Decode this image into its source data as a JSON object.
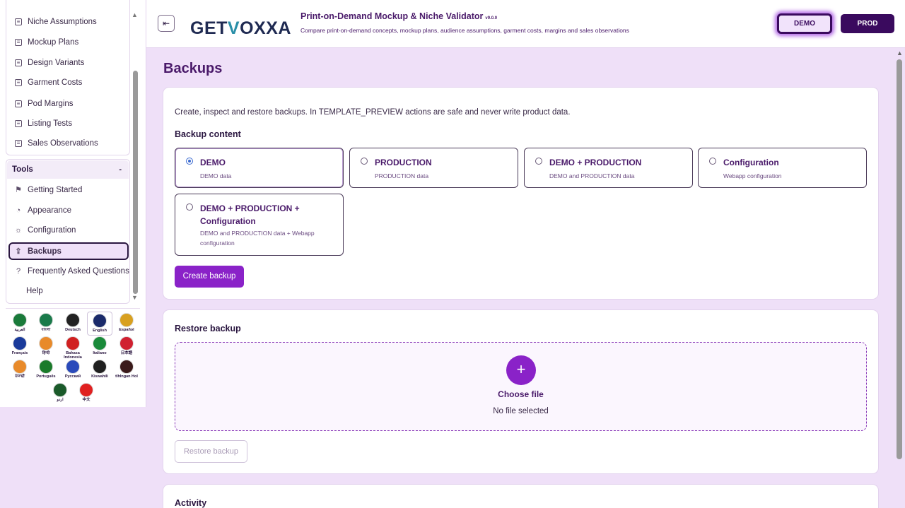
{
  "sidebar": {
    "nav_items": [
      {
        "label": "Niche Assumptions",
        "icon": "list-icon"
      },
      {
        "label": "Mockup Plans",
        "icon": "list-icon"
      },
      {
        "label": "Design Variants",
        "icon": "list-icon"
      },
      {
        "label": "Garment Costs",
        "icon": "list-icon"
      },
      {
        "label": "Pod Margins",
        "icon": "list-icon"
      },
      {
        "label": "Listing Tests",
        "icon": "list-icon"
      },
      {
        "label": "Sales Observations",
        "icon": "list-icon"
      }
    ],
    "tools_title": "Tools",
    "tools_caret": "-",
    "tools_items": [
      {
        "label": "Getting Started",
        "icon": "flag-icon"
      },
      {
        "label": "Appearance",
        "icon": "palette-icon"
      },
      {
        "label": "Configuration",
        "icon": "gear-icon"
      },
      {
        "label": "Backups",
        "icon": "upload-icon"
      },
      {
        "label": "Frequently Asked Questions",
        "icon": "help-icon"
      },
      {
        "label": "Help",
        "icon": ""
      }
    ],
    "languages": [
      {
        "label": "العربية",
        "color": "#1a7a3a"
      },
      {
        "label": "বাংলা",
        "color": "#1a7a4a"
      },
      {
        "label": "Deutsch",
        "color": "#222222"
      },
      {
        "label": "English",
        "color": "#1a2a6a"
      },
      {
        "label": "Español",
        "color": "#d8a020"
      },
      {
        "label": "Français",
        "color": "#1a3a9a"
      },
      {
        "label": "हिन्दी",
        "color": "#e88a2a"
      },
      {
        "label": "Bahasa Indonesia",
        "color": "#d02020"
      },
      {
        "label": "Italiano",
        "color": "#1a8a3a"
      },
      {
        "label": "日本語",
        "color": "#d02030"
      },
      {
        "label": "ਪੰਜਾਬੀ",
        "color": "#e88a2a"
      },
      {
        "label": "Português",
        "color": "#1a7a2a"
      },
      {
        "label": "Русский",
        "color": "#2a4aba"
      },
      {
        "label": "Kiswahili",
        "color": "#202020"
      },
      {
        "label": "tlhIngan Hol",
        "color": "#3a1a1a"
      },
      {
        "label": "اردو",
        "color": "#1a5a2a"
      },
      {
        "label": "中文",
        "color": "#e02020"
      }
    ]
  },
  "header": {
    "logo_pre": "GET",
    "logo_v": "V",
    "logo_post": "OXXA",
    "title": "Print-on-Demand Mockup & Niche Validator",
    "version": "v9.0.0",
    "subtitle": "Compare print-on-demand concepts, mockup plans, audience assumptions, garment costs, margins and sales observations",
    "demo_label": "DEMO",
    "prod_label": "PROD"
  },
  "main": {
    "page_title": "Backups",
    "intro": "Create, inspect and restore backups. In TEMPLATE_PREVIEW actions are safe and never write product data.",
    "backup_content_title": "Backup content",
    "options": [
      {
        "title": "DEMO",
        "desc": "DEMO data",
        "selected": true
      },
      {
        "title": "PRODUCTION",
        "desc": "PRODUCTION data",
        "selected": false
      },
      {
        "title": "DEMO + PRODUCTION",
        "desc": "DEMO and PRODUCTION data",
        "selected": false
      },
      {
        "title": "Configuration",
        "desc": "Webapp configuration",
        "selected": false
      },
      {
        "title": "DEMO + PRODUCTION + Configuration",
        "desc": "DEMO and PRODUCTION data + Webapp configuration",
        "selected": false
      }
    ],
    "create_button": "Create backup",
    "restore_title": "Restore backup",
    "choose_file": "Choose file",
    "no_file": "No file selected",
    "restore_button": "Restore backup",
    "activity_title": "Activity"
  },
  "colors": {
    "accent": "#8a22c8",
    "brand_dark": "#3a0a5e",
    "background": "#efe0f8"
  }
}
